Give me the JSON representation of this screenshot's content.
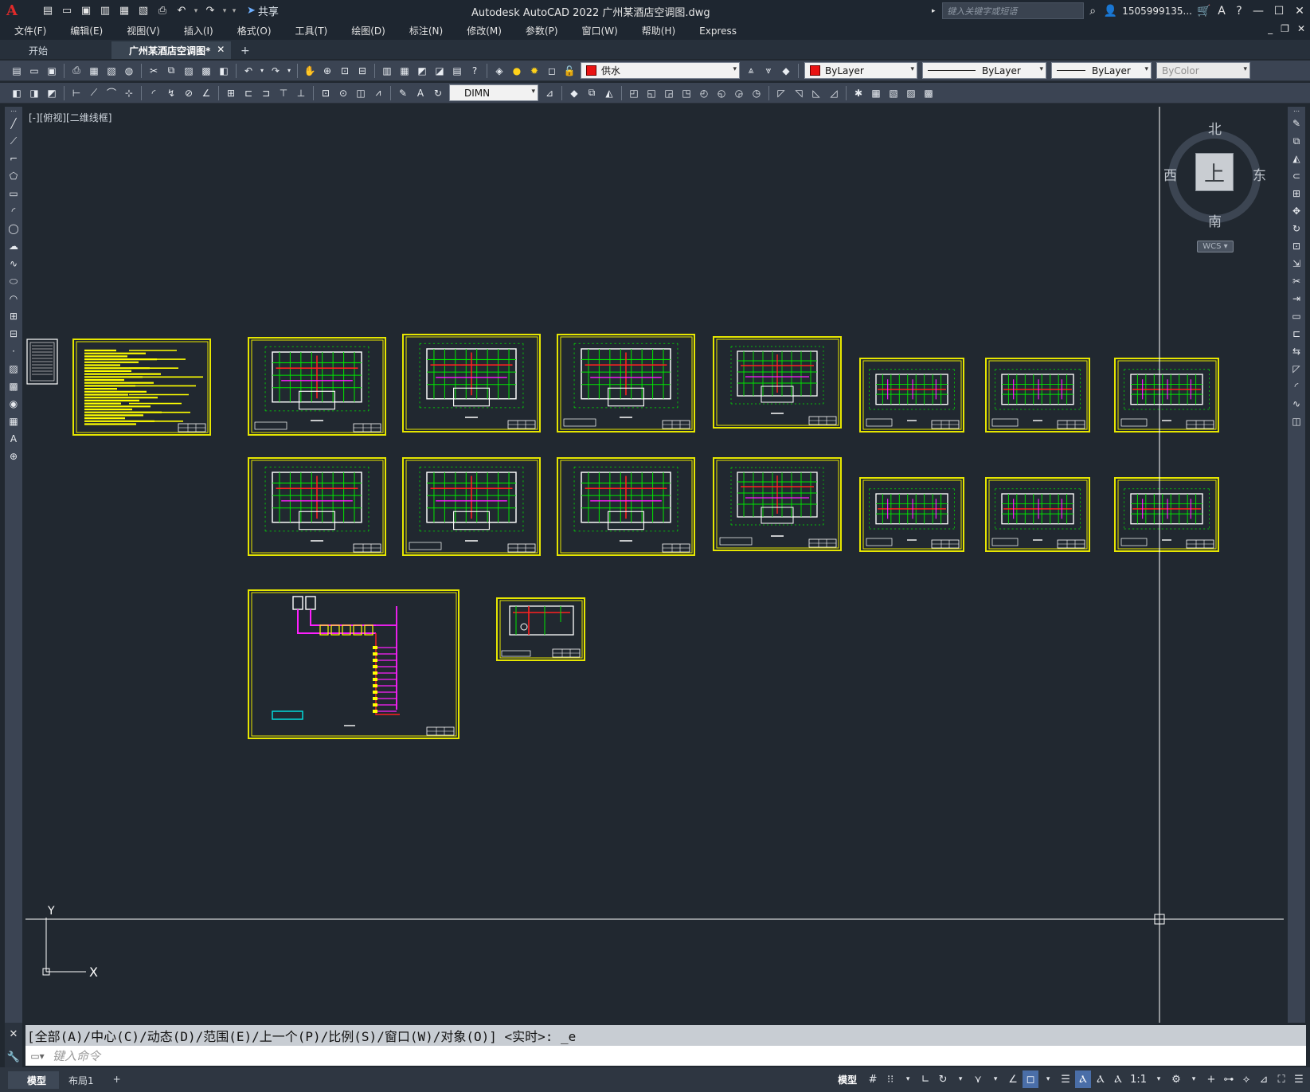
{
  "titlebar": {
    "app_title": "Autodesk AutoCAD 2022    广州某酒店空调图.dwg",
    "share_label": "共享",
    "search_placeholder": "键入关键字或短语",
    "user_name": "1505999135...",
    "logo_letter": "A"
  },
  "menu": {
    "items": [
      "文件(F)",
      "编辑(E)",
      "视图(V)",
      "插入(I)",
      "格式(O)",
      "工具(T)",
      "绘图(D)",
      "标注(N)",
      "修改(M)",
      "参数(P)",
      "窗口(W)",
      "帮助(H)",
      "Express"
    ]
  },
  "tabs": {
    "start_label": "开始",
    "active_doc": "广州某酒店空调图*",
    "close_glyph": "✕",
    "add_glyph": "+"
  },
  "toolbar1": {
    "layer_name": "供水",
    "color_value": "ByLayer",
    "linetype_value": "ByLayer",
    "lineweight_value": "ByLayer",
    "plotstyle_value": "ByColor",
    "layer_color": "#e81313"
  },
  "toolbar2": {
    "dimstyle_value": "DIMN"
  },
  "viewport": {
    "label": "[-][俯视][二维线框]",
    "axis_y": "Y",
    "axis_x": "X"
  },
  "viewcube": {
    "north": "北",
    "south": "南",
    "east": "东",
    "west": "西",
    "face": "上",
    "wcs": "WCS"
  },
  "command": {
    "history": "[全部(A)/中心(C)/动态(D)/范围(E)/上一个(P)/比例(S)/窗口(W)/对象(O)] <实时>: _e",
    "placeholder": "键入命令"
  },
  "statusbar": {
    "model_tab": "模型",
    "layout_tab": "布局1",
    "add_tab": "+",
    "model_button": "模型",
    "scale": "1:1"
  },
  "colors": {
    "sheet_border": "#e6e600",
    "wall": "#00e600",
    "pipe_red": "#ff2020",
    "pipe_magenta": "#ff20ff",
    "annotation": "#ffffff",
    "background": "#212830"
  }
}
